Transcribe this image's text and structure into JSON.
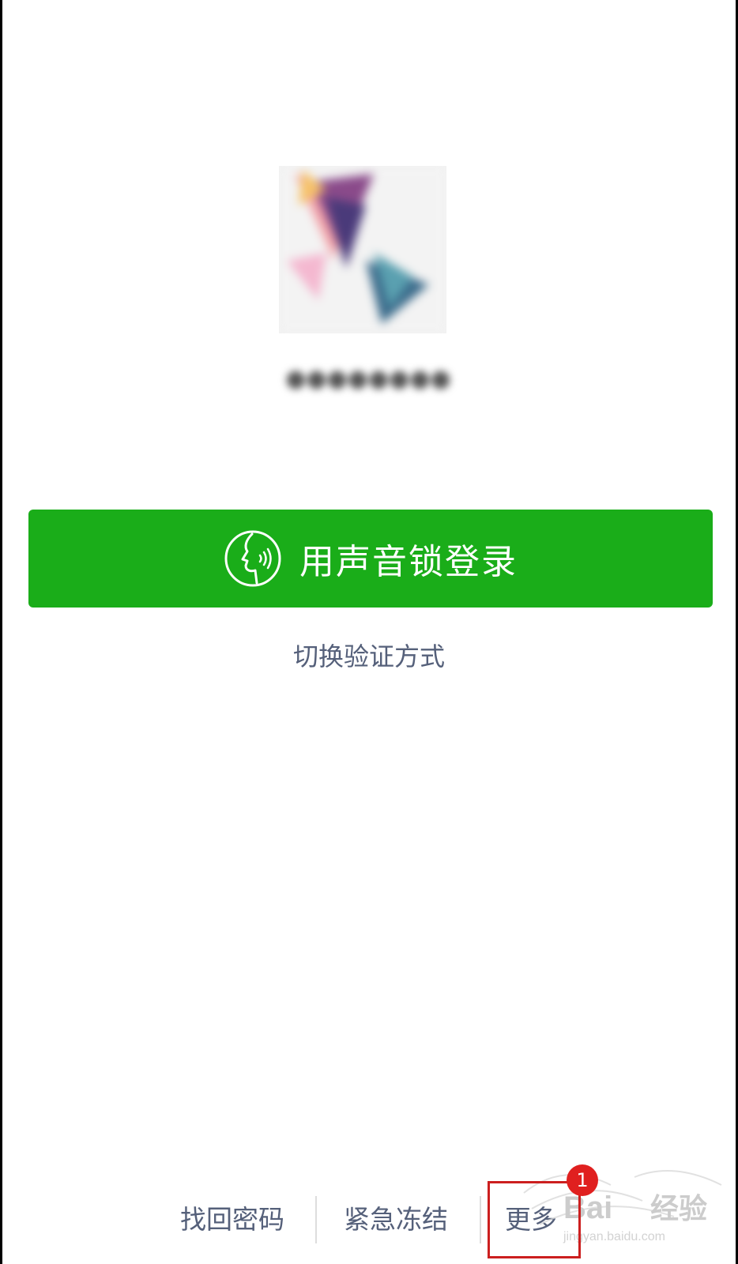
{
  "avatar": {
    "icon": "blurred-profile-avatar"
  },
  "nickname": {
    "text": "●●●●●●●●"
  },
  "login": {
    "button_label": "用声音锁登录",
    "icon": "voice-lock-face-icon",
    "color": "#1aad19"
  },
  "switch_method": {
    "label": "切换验证方式"
  },
  "footer": {
    "recover_password": "找回密码",
    "emergency_freeze": "紧急冻结",
    "more": "更多",
    "more_badge": "1"
  },
  "colors": {
    "primary_green": "#1aad19",
    "link_text": "#55607a",
    "highlight_red": "#cc1f1f",
    "badge_red": "#e0201f"
  },
  "watermark": {
    "logo": "Baidu经验",
    "url": "jingyan.baidu.com"
  }
}
